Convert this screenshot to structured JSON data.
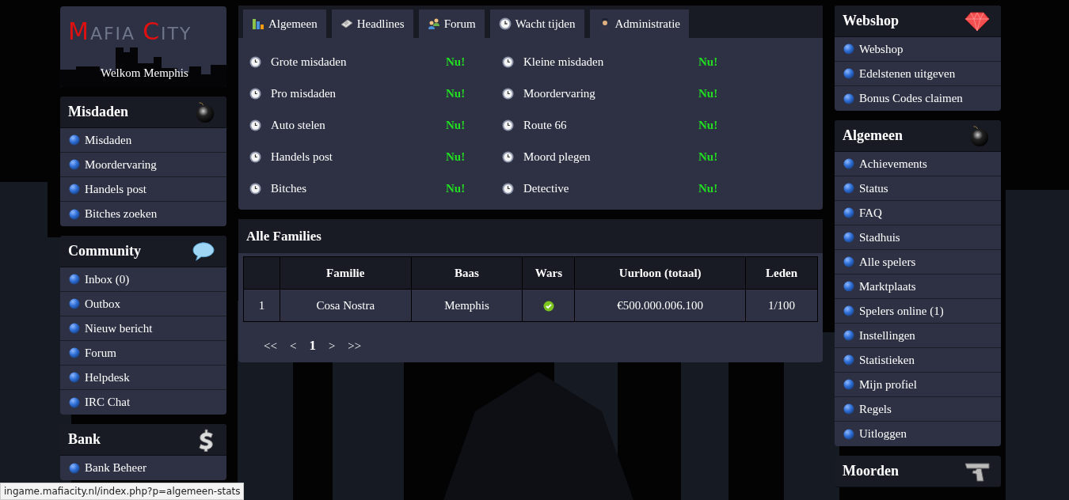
{
  "logo": {
    "parts": [
      {
        "text": "M",
        "accent": true
      },
      {
        "text": "AFIA ",
        "accent": false
      },
      {
        "text": "C",
        "accent": true
      },
      {
        "text": "ITY",
        "accent": false
      }
    ],
    "welcome": "Welkom Memphis"
  },
  "left_panels": [
    {
      "title": "Misdaden",
      "items": [
        "Misdaden",
        "Moordervaring",
        "Handels post",
        "Bitches zoeken"
      ]
    },
    {
      "title": "Community",
      "items": [
        "Inbox (0)",
        "Outbox",
        "Nieuw bericht",
        "Forum",
        "Helpdesk",
        "IRC Chat"
      ]
    },
    {
      "title": "Bank",
      "items": [
        "Bank Beheer"
      ]
    }
  ],
  "tabs": [
    "Algemeen",
    "Headlines",
    "Forum",
    "Wacht tijden",
    "Administratie"
  ],
  "timers": [
    [
      {
        "label": "Grote misdaden",
        "status": "Nu!"
      },
      {
        "label": "Pro misdaden",
        "status": "Nu!"
      },
      {
        "label": "Auto stelen",
        "status": "Nu!"
      },
      {
        "label": "Handels post",
        "status": "Nu!"
      },
      {
        "label": "Bitches",
        "status": "Nu!"
      }
    ],
    [
      {
        "label": "Kleine misdaden",
        "status": "Nu!"
      },
      {
        "label": "Moordervaring",
        "status": "Nu!"
      },
      {
        "label": "Route 66",
        "status": "Nu!"
      },
      {
        "label": "Moord plegen",
        "status": "Nu!"
      },
      {
        "label": "Detective",
        "status": "Nu!"
      }
    ]
  ],
  "families": {
    "title": "Alle Families",
    "columns": [
      "Familie",
      "Baas",
      "Wars",
      "Uurloon (totaal)",
      "Leden"
    ],
    "rows": [
      {
        "rank": "1",
        "familie": "Cosa Nostra",
        "baas": "Memphis",
        "wars": true,
        "uurloon": "€500.000.006.100",
        "leden": "1/100"
      }
    ],
    "pagination": {
      "first": "<<",
      "prev": "<",
      "current": "1",
      "next": ">",
      "last": ">>"
    }
  },
  "right_panels": [
    {
      "title": "Webshop",
      "items": [
        "Webshop",
        "Edelstenen uitgeven",
        "Bonus Codes claimen"
      ]
    },
    {
      "title": "Algemeen",
      "items": [
        "Achievements",
        "Status",
        "FAQ",
        "Stadhuis",
        "Alle spelers",
        "Marktplaats",
        "Spelers online (1)",
        "Instellingen",
        "Statistieken",
        "Mijn profiel",
        "Regels",
        "Uitloggen"
      ]
    },
    {
      "title": "Moorden"
    }
  ],
  "status_bar": {
    "url": "ingame.mafiacity.nl/index.php?p=algemeen-stats"
  }
}
